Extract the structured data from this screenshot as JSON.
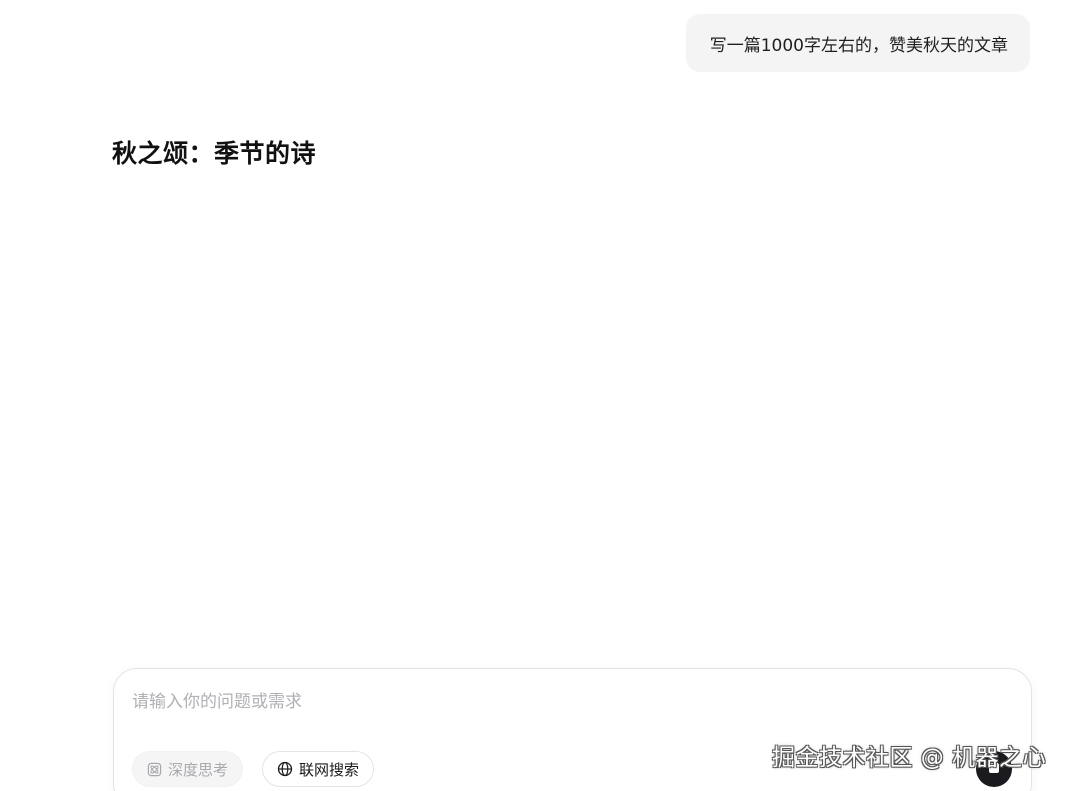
{
  "conversation": {
    "user_message": "写一篇1000字左右的，赞美秋天的文章",
    "answer_title": "秋之颂：季节的诗"
  },
  "composer": {
    "placeholder": "请输入你的问题或需求",
    "value": "",
    "deep_think_label": "深度思考",
    "web_search_label": "联网搜索",
    "deep_think_icon": "atom-icon",
    "web_search_icon": "globe-icon",
    "send_icon": "send-icon"
  },
  "watermark": {
    "text": "掘金技术社区 @ 机器之心"
  },
  "colors": {
    "bubble_bg": "#f4f4f5",
    "send_button": "#1b1b1f",
    "placeholder": "#b0b0b5"
  }
}
